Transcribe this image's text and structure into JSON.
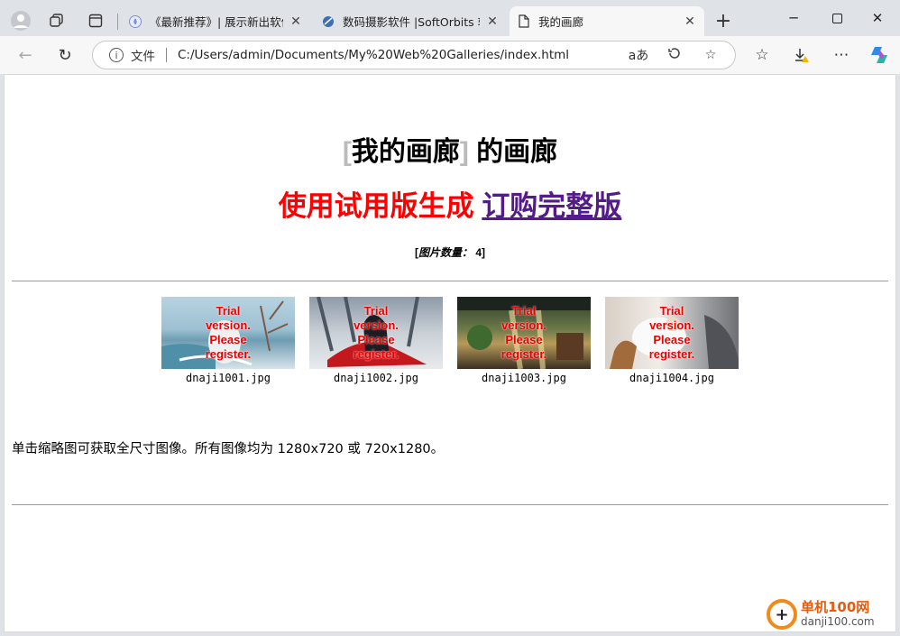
{
  "browser": {
    "tabs": [
      {
        "title": "《最新推荐》| 展示新出软件",
        "active": false
      },
      {
        "title": "数码摄影软件 |SoftOrbits 软件",
        "active": false
      },
      {
        "title": "我的画廊",
        "active": true
      }
    ],
    "address": {
      "file_label": "文件",
      "url": "C:/Users/admin/Documents/My%20Web%20Galleries/index.html",
      "read_aloud": "aあ"
    }
  },
  "page": {
    "title_bracket_open": "[",
    "title_name": "我的画廊",
    "title_bracket_close": "]",
    "title_suffix": " 的画廊",
    "trial_text": "使用试用版生成",
    "order_link": "订购完整版",
    "count_label": "图片数量：",
    "count_value": "4",
    "thumbnails": [
      {
        "file": "dnaji1001.jpg",
        "watermark": [
          "Trial",
          "version.",
          "Please",
          "register."
        ]
      },
      {
        "file": "dnaji1002.jpg",
        "watermark": [
          "Trial",
          "version.",
          "Please",
          "register."
        ]
      },
      {
        "file": "dnaji1003.jpg",
        "watermark": [
          "Trial",
          "version.",
          "Please",
          "register."
        ]
      },
      {
        "file": "dnaji1004.jpg",
        "watermark": [
          "Trial",
          "version.",
          "Please",
          "register."
        ]
      }
    ],
    "description": "单击缩略图可获取全尺寸图像。所有图像均为 1280x720 或 720x1280。"
  },
  "site_watermark": {
    "name": "单机100网",
    "domain": "danji100.com"
  },
  "colors": {
    "trial": "#ff0000",
    "link": "#551a8b",
    "bracket": "#bbbbbb"
  }
}
